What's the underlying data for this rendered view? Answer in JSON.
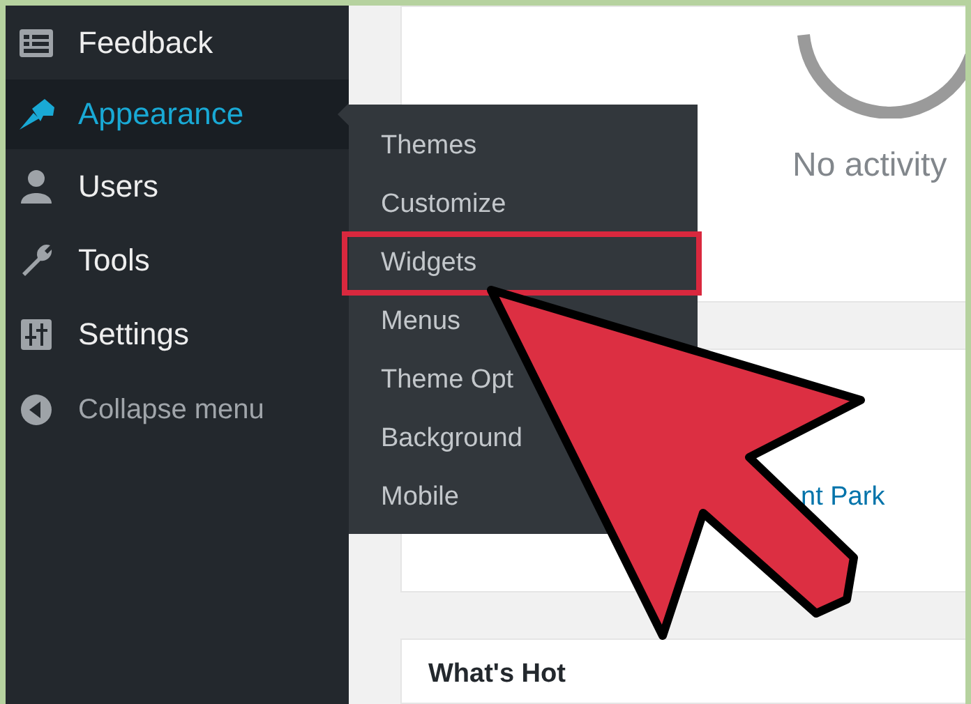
{
  "sidebar": {
    "items": [
      {
        "label": "Feedback",
        "selected": false
      },
      {
        "label": "Appearance",
        "selected": true
      },
      {
        "label": "Users",
        "selected": false
      },
      {
        "label": "Tools",
        "selected": false
      },
      {
        "label": "Settings",
        "selected": false
      },
      {
        "label": "Collapse menu",
        "selected": false,
        "kind": "collapse"
      }
    ]
  },
  "submenu": {
    "items": [
      {
        "label": "Themes",
        "highlighted": false
      },
      {
        "label": "Customize",
        "highlighted": false
      },
      {
        "label": "Widgets",
        "highlighted": true
      },
      {
        "label": "Menus",
        "highlighted": false
      },
      {
        "label": "Theme Opt",
        "highlighted": false
      },
      {
        "label": "Background",
        "highlighted": false
      },
      {
        "label": "Mobile",
        "highlighted": false
      }
    ]
  },
  "activity_card": {
    "message": "No activity"
  },
  "events_card": {
    "link": "nt Park"
  },
  "hot_card": {
    "title": "What's Hot"
  }
}
